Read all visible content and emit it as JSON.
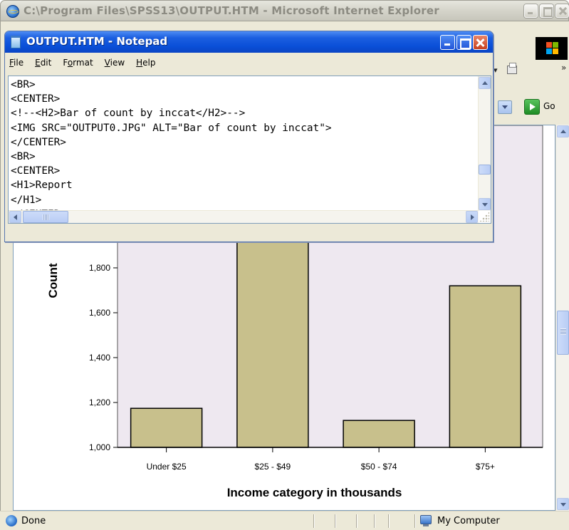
{
  "browser": {
    "title": "C:\\Program Files\\SPSS13\\OUTPUT.HTM - Microsoft Internet Explorer",
    "go_label": "Go",
    "status_text": "Done",
    "zone_text": "My Computer"
  },
  "notepad": {
    "title": "OUTPUT.HTM - Notepad",
    "menu": [
      {
        "label": "File",
        "key": "F"
      },
      {
        "label": "Edit",
        "key": "E"
      },
      {
        "label": "Format",
        "key": "o"
      },
      {
        "label": "View",
        "key": "V"
      },
      {
        "label": "Help",
        "key": "H"
      }
    ],
    "lines": [
      "<BR>",
      "<CENTER>",
      "<!--<H2>Bar of count by inccat</H2>-->",
      "<IMG SRC=\"OUTPUT0.JPG\" ALT=\"Bar of count by inccat\">",
      "</CENTER>",
      "<BR>",
      "<CENTER>",
      "<H1>Report",
      "</H1>",
      "</CENTER>"
    ]
  },
  "chart_data": {
    "type": "bar",
    "categories": [
      "Under $25",
      "$25 - $49",
      "$50 - $74",
      "$75+"
    ],
    "values": [
      1174,
      2100,
      1120,
      1720
    ],
    "xlabel": "Income category in thousands",
    "ylabel": "Count",
    "ylim": [
      1000,
      2100
    ],
    "yticks": [
      "1,000",
      "1,200",
      "1,400",
      "1,600",
      "1,800"
    ],
    "ytick_values": [
      1000,
      1200,
      1400,
      1600,
      1800
    ],
    "bar_color": "#c8c08c",
    "plot_background": "#eee8f0",
    "grid": false
  },
  "colors": {
    "xp_blue": "#0a4fd8",
    "window_face": "#ece9d8"
  }
}
